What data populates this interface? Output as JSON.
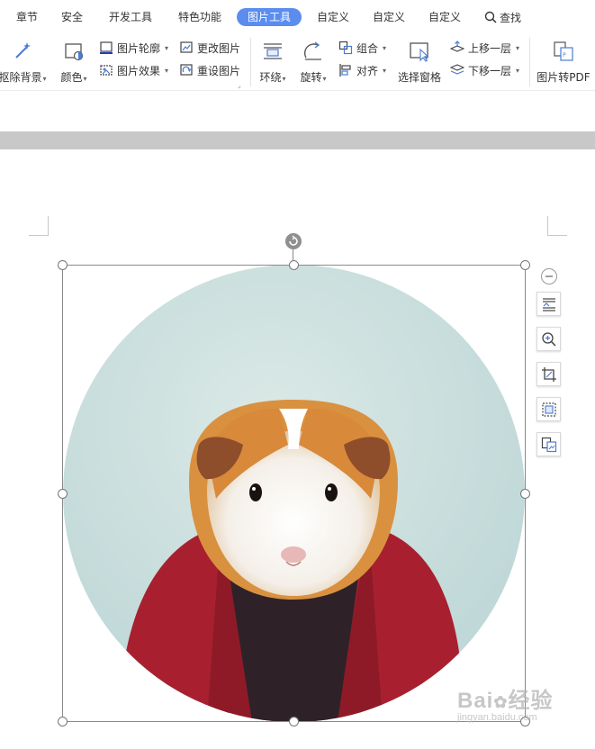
{
  "tabs": [
    {
      "label": "章节",
      "active": false
    },
    {
      "label": "安全",
      "active": false
    },
    {
      "label": "开发工具",
      "active": false
    },
    {
      "label": "特色功能",
      "active": false
    },
    {
      "label": "图片工具",
      "active": true
    },
    {
      "label": "自定义",
      "active": false
    },
    {
      "label": "自定义",
      "active": false
    },
    {
      "label": "自定义",
      "active": false
    }
  ],
  "search_label": "查找",
  "ribbon": {
    "remove_bg": "抠除背景",
    "color": "颜色",
    "pic_outline": "图片轮廓",
    "pic_effect": "图片效果",
    "change_pic": "更改图片",
    "reset_pic": "重设图片",
    "wrap": "环绕",
    "rotate": "旋转",
    "group": "组合",
    "align": "对齐",
    "selection_pane": "选择窗格",
    "bring_forward": "上移一层",
    "send_backward": "下移一层",
    "to_pdf": "图片转PDF"
  },
  "watermark": {
    "line1": "Bai",
    "line1b": "经验",
    "line2": "jingyan.baidu.com"
  },
  "colors": {
    "accent": "#5b8def",
    "jacket": "#a8202f",
    "shirt": "#2e2228",
    "background_circle": "#cfe3e0"
  }
}
